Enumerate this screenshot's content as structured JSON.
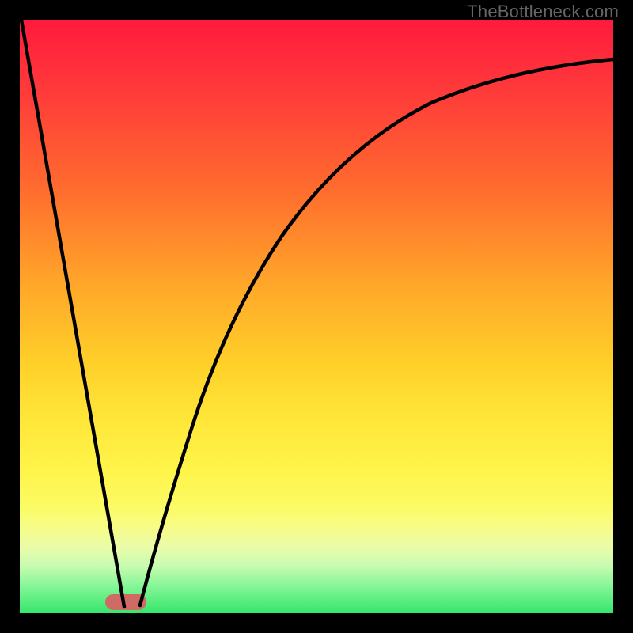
{
  "watermark": "TheBottleneck.com",
  "colors": {
    "frame": "#000000",
    "watermark_text": "#666666",
    "curve": "#000000",
    "pill": "#cf6a65",
    "gradient_top": "#ff1a3d",
    "gradient_bottom": "#35e66c"
  },
  "chart_data": {
    "type": "line",
    "title": "",
    "xlabel": "",
    "ylabel": "",
    "xlim": [
      0,
      100
    ],
    "ylim": [
      0,
      100
    ],
    "grid": false,
    "legend": false,
    "series": [
      {
        "name": "left-descent",
        "x": [
          0,
          6,
          12,
          17
        ],
        "values": [
          100,
          65,
          30,
          1
        ]
      },
      {
        "name": "right-ascent",
        "x": [
          20,
          24,
          30,
          38,
          48,
          60,
          74,
          88,
          100
        ],
        "values": [
          1,
          15,
          32,
          50,
          65,
          77,
          85,
          90,
          93
        ]
      }
    ],
    "annotations": [
      {
        "name": "minimum-marker-pill",
        "x_range": [
          15,
          21
        ],
        "y": 1
      }
    ],
    "background_gradient": {
      "orientation": "vertical",
      "stops": [
        {
          "pos": 0.0,
          "color": "#ff1a3d"
        },
        {
          "pos": 0.28,
          "color": "#ff6a2e"
        },
        {
          "pos": 0.58,
          "color": "#ffd029"
        },
        {
          "pos": 0.82,
          "color": "#fbfb64"
        },
        {
          "pos": 0.95,
          "color": "#8df79b"
        },
        {
          "pos": 1.0,
          "color": "#35e66c"
        }
      ]
    }
  }
}
